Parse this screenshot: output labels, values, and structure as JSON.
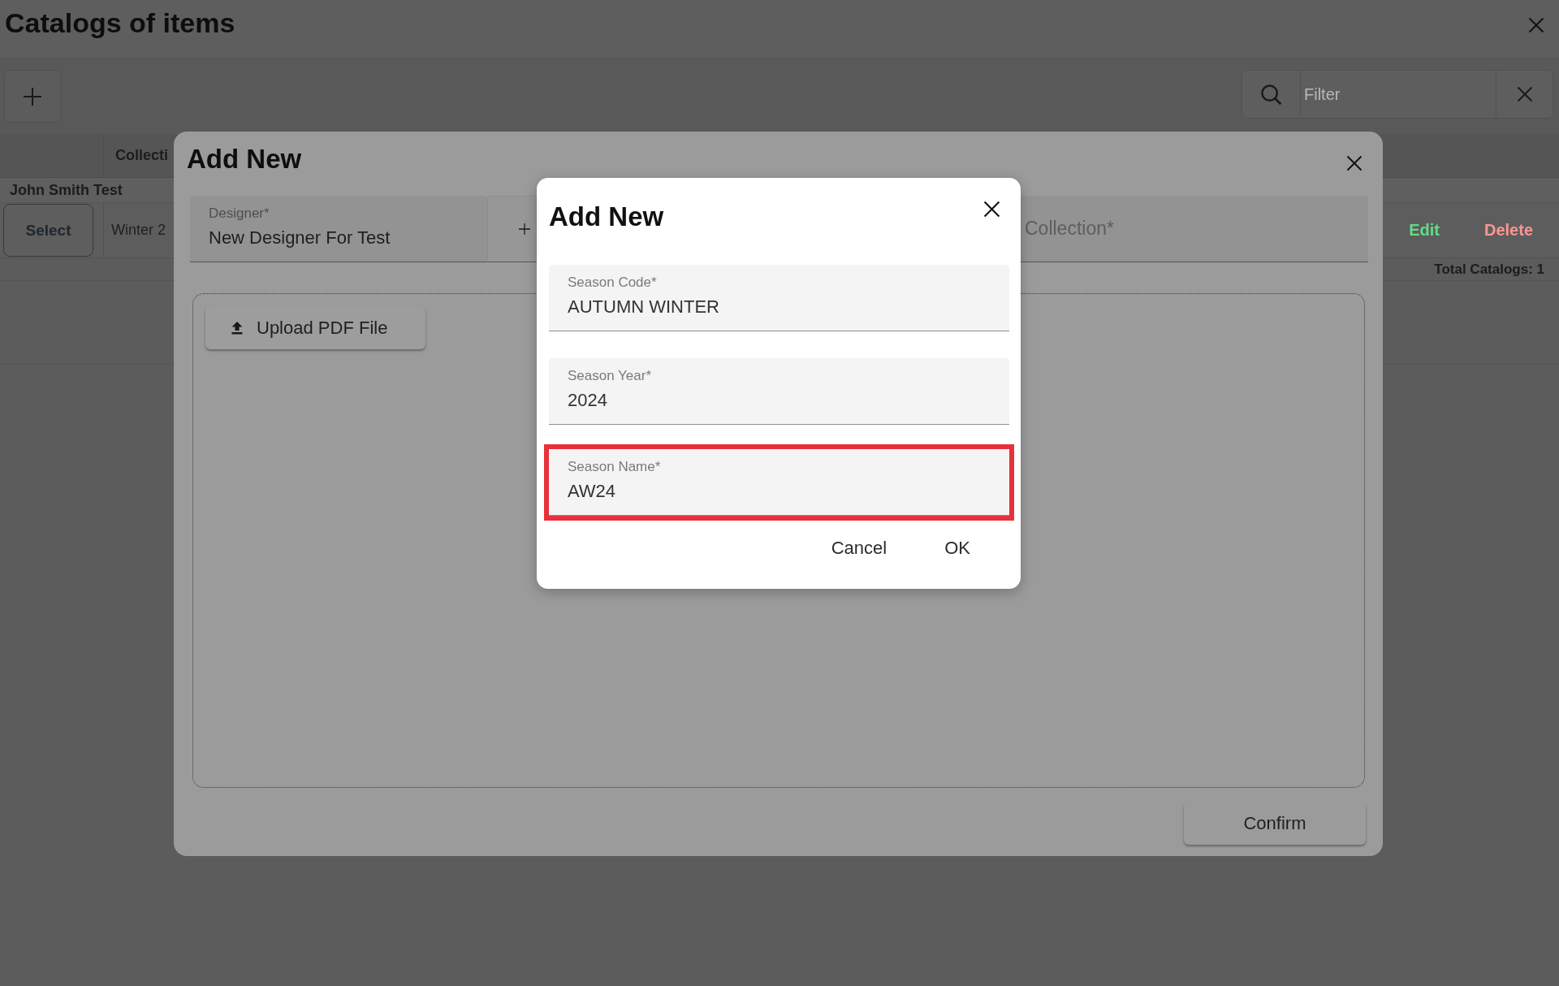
{
  "window": {
    "title": "Catalogs of items"
  },
  "toolbar": {
    "filter": {
      "placeholder": "Filter"
    }
  },
  "table": {
    "columns": [
      "Collecti"
    ],
    "groups": [
      {
        "name": "John Smith Test",
        "rows": [
          {
            "button": "Select",
            "cells": [
              "Winter 2"
            ],
            "actions": [
              {
                "label": "Edit",
                "color": "#62dc88"
              },
              {
                "label": "Delete",
                "color": "#ff9494"
              }
            ]
          }
        ]
      }
    ],
    "total": "Total Catalogs: 1"
  },
  "dialog": {
    "title": "Add New",
    "designer": {
      "label": "Designer*",
      "value": "New Designer For Test"
    },
    "collection": {
      "placeholder": "Collection*"
    },
    "upload_button": "Upload PDF File",
    "confirm_button": "Confirm"
  },
  "season_dialog": {
    "title": "Add New",
    "fields": [
      {
        "label": "Season Code*",
        "value": "AUTUMN WINTER",
        "highlighted": false
      },
      {
        "label": "Season Year*",
        "value": "2024",
        "highlighted": false
      },
      {
        "label": "Season Name*",
        "value": "AW24",
        "highlighted": true
      }
    ],
    "buttons": [
      "Cancel",
      "OK"
    ]
  }
}
